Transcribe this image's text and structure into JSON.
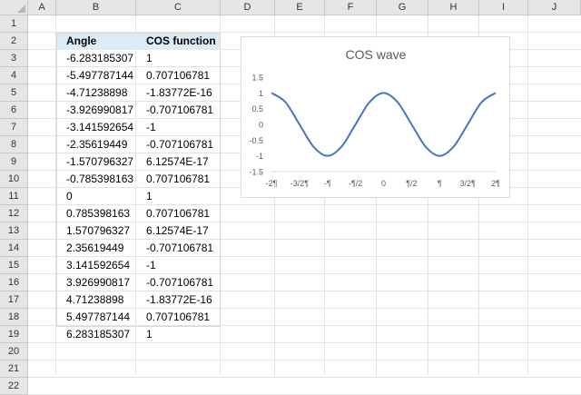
{
  "columns": [
    "A",
    "B",
    "C",
    "D",
    "E",
    "F",
    "G",
    "H",
    "I",
    "J"
  ],
  "rows": [
    "1",
    "2",
    "3",
    "4",
    "5",
    "6",
    "7",
    "8",
    "9",
    "10",
    "11",
    "12",
    "13",
    "14",
    "15",
    "16",
    "17",
    "18",
    "19",
    "20",
    "21",
    "22"
  ],
  "table": {
    "headers": [
      "Angle",
      "COS function"
    ],
    "angles": [
      "-6.283185307",
      "-5.497787144",
      "-4.71238898",
      "-3.926990817",
      "-3.141592654",
      "-2.35619449",
      "-1.570796327",
      "-0.785398163",
      "0",
      "0.785398163",
      "1.570796327",
      "2.35619449",
      "3.141592654",
      "3.926990817",
      "4.71238898",
      "5.497787144",
      "6.283185307"
    ],
    "cos_values": [
      "1",
      "0.707106781",
      "-1.83772E-16",
      "-0.707106781",
      "-1",
      "-0.707106781",
      "6.12574E-17",
      "0.707106781",
      "1",
      "0.707106781",
      "6.12574E-17",
      "-0.707106781",
      "-1",
      "-0.707106781",
      "-1.83772E-16",
      "0.707106781",
      "1"
    ]
  },
  "colors": {
    "line": "#4472c4",
    "header_fill": "#ddebf7",
    "gridline": "#d9d9d9"
  },
  "chart_data": {
    "type": "line",
    "title": "COS wave",
    "x": [
      -6.283185307,
      -5.497787144,
      -4.71238898,
      -3.926990817,
      -3.141592654,
      -2.35619449,
      -1.570796327,
      -0.785398163,
      0,
      0.785398163,
      1.570796327,
      2.35619449,
      3.141592654,
      3.926990817,
      4.71238898,
      5.497787144,
      6.283185307
    ],
    "y": [
      1,
      0.707106781,
      0,
      -0.707106781,
      -1,
      -0.707106781,
      0,
      0.707106781,
      1,
      0.707106781,
      0,
      -0.707106781,
      -1,
      -0.707106781,
      0,
      0.707106781,
      1
    ],
    "xlim": [
      -6.283185307,
      6.283185307
    ],
    "ylim": [
      -1.5,
      1.5
    ],
    "y_ticks": [
      "1.5",
      "1",
      "0.5",
      "0",
      "-0.5",
      "-1",
      "-1.5"
    ],
    "x_tick_labels": [
      "-2¶",
      "-3/2¶",
      "-¶",
      "-¶/2",
      "0",
      "¶/2",
      "¶",
      "3/2¶",
      "2¶"
    ],
    "grid": false,
    "legend": "none",
    "smooth": true
  }
}
